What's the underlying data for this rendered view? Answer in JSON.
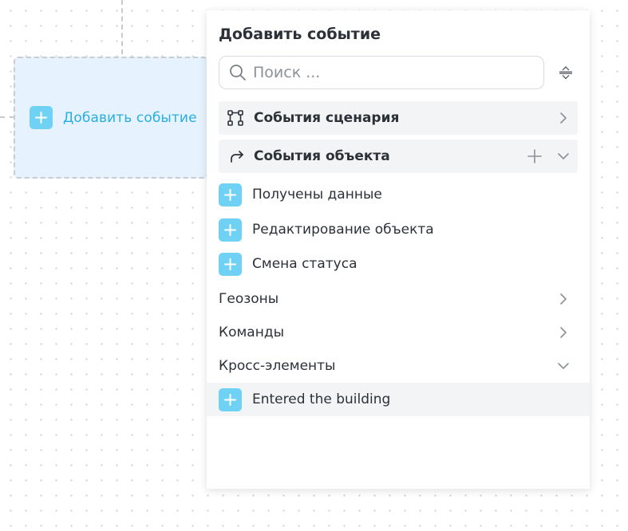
{
  "canvas": {
    "node": {
      "add_label": "Добавить событие"
    }
  },
  "panel": {
    "title": "Добавить событие",
    "search": {
      "placeholder": "Поиск ...",
      "value": ""
    },
    "groups": [
      {
        "label": "События сценария",
        "icon": "flow-nodes-icon",
        "state": "collapsed"
      },
      {
        "label": "События объекта",
        "icon": "redo-arrow-icon",
        "state": "expanded"
      }
    ],
    "object_events": [
      {
        "label": "Получены данные"
      },
      {
        "label": "Редактирование объекта"
      },
      {
        "label": "Смена статуса"
      }
    ],
    "categories": [
      {
        "label": "Геозоны",
        "state": "collapsed"
      },
      {
        "label": "Команды",
        "state": "collapsed"
      },
      {
        "label": "Кросс-элементы",
        "state": "expanded"
      }
    ],
    "cross_elements": [
      {
        "label": "Entered the building"
      }
    ]
  },
  "colors": {
    "accent": "#29aee0",
    "plus_box": "#6fd2f5",
    "node_bg": "#e6f2fd",
    "group_bg": "#f3f4f6"
  }
}
